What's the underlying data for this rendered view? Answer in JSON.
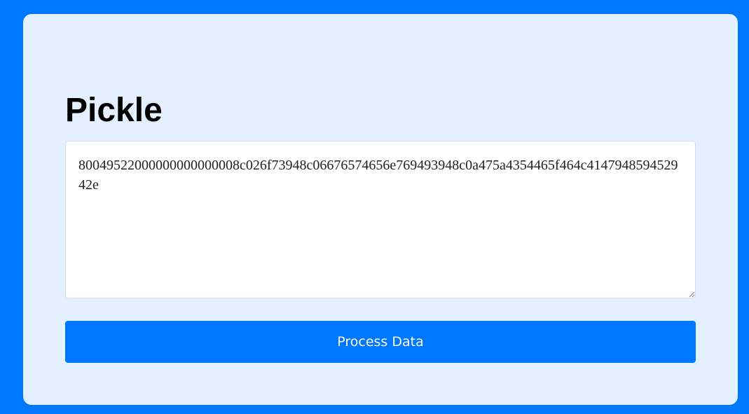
{
  "card": {
    "title": "Pickle",
    "textarea_value": "80049522000000000000008c026f73948c06676574656e769493948c0a475a4354465f464c414794859452942e",
    "button_label": "Process Data"
  },
  "colors": {
    "page_background": "#0077ff",
    "card_background": "#e4f0ff",
    "button_background": "#0077ff",
    "button_text": "#ffffff"
  }
}
